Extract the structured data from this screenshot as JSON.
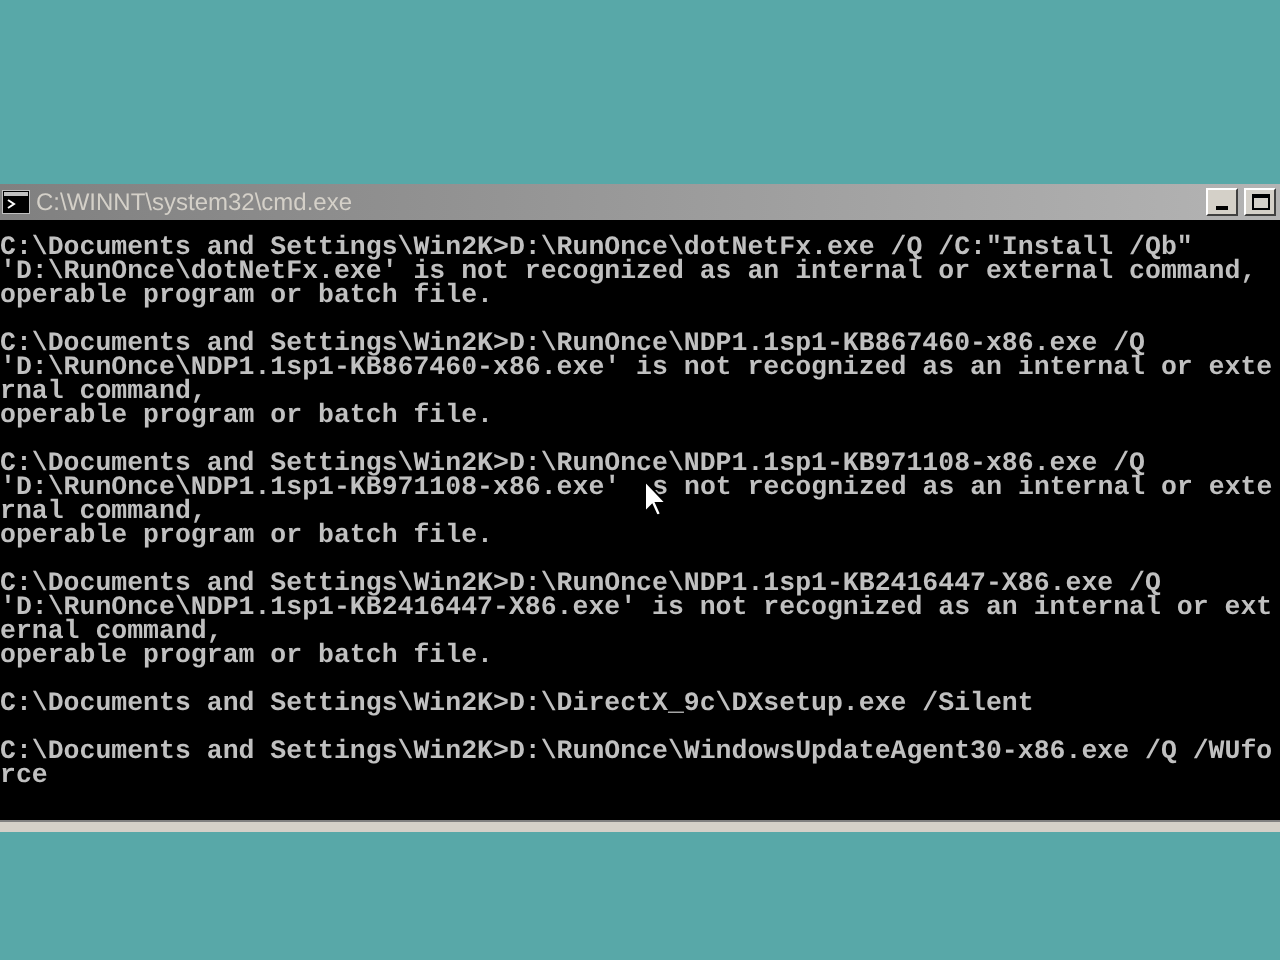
{
  "window": {
    "title": "C:\\WINNT\\system32\\cmd.exe"
  },
  "console": {
    "blocks": [
      [
        "C:\\Documents and Settings\\Win2K>D:\\RunOnce\\dotNetFx.exe /Q /C:\"Install /Qb\"",
        "'D:\\RunOnce\\dotNetFx.exe' is not recognized as an internal or external command,",
        "operable program or batch file."
      ],
      [
        "C:\\Documents and Settings\\Win2K>D:\\RunOnce\\NDP1.1sp1-KB867460-x86.exe /Q",
        "'D:\\RunOnce\\NDP1.1sp1-KB867460-x86.exe' is not recognized as an internal or exte",
        "rnal command,",
        "operable program or batch file."
      ],
      [
        "C:\\Documents and Settings\\Win2K>D:\\RunOnce\\NDP1.1sp1-KB971108-x86.exe /Q",
        [
          "'D:\\RunOnce\\NDP1.1sp1-KB971108-x86.exe'",
          "s not recognized as an internal or exte"
        ],
        "rnal command,",
        "operable program or batch file."
      ],
      [
        "C:\\Documents and Settings\\Win2K>D:\\RunOnce\\NDP1.1sp1-KB2416447-X86.exe /Q",
        "'D:\\RunOnce\\NDP1.1sp1-KB2416447-X86.exe' is not recognized as an internal or ext",
        "ernal command,",
        "operable program or batch file."
      ],
      [
        "C:\\Documents and Settings\\Win2K>D:\\DirectX_9c\\DXsetup.exe /Silent"
      ],
      [
        "C:\\Documents and Settings\\Win2K>D:\\RunOnce\\WindowsUpdateAgent30-x86.exe /Q /WUfo",
        "rce"
      ]
    ]
  }
}
